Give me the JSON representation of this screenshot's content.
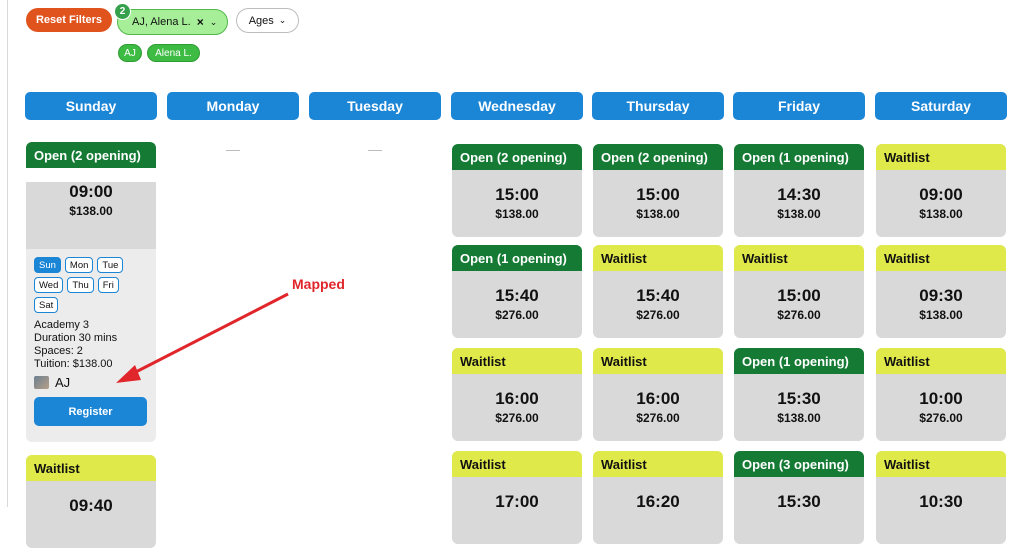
{
  "filters": {
    "reset_label": "Reset Filters",
    "selected_count": "2",
    "coach_filter_label": "AJ, Alena L.",
    "clear_symbol": "×",
    "ages_label": "Ages",
    "tags": [
      "AJ",
      "Alena L."
    ]
  },
  "days": [
    "Sunday",
    "Monday",
    "Tuesday",
    "Wednesday",
    "Thursday",
    "Friday",
    "Saturday"
  ],
  "empty_marker": "—",
  "expanded": {
    "status": "Open (2 opening)",
    "time": "09:00",
    "price": "$138.00",
    "day_pills": [
      "Sun",
      "Mon",
      "Tue",
      "Wed",
      "Thu",
      "Fri",
      "Sat"
    ],
    "selected_day": "Sun",
    "program": "Academy 3",
    "duration": "Duration 30 mins",
    "spaces": "Spaces: 2",
    "tuition": "Tuition: $138.00",
    "coach": "AJ",
    "register_label": "Register"
  },
  "annotation": {
    "label": "Mapped",
    "color": "#e0262a"
  },
  "columns": {
    "sunday": [
      {
        "status": "Waitlist",
        "type": "wait",
        "time": "09:40",
        "price": ""
      }
    ],
    "wednesday": [
      {
        "status": "Open (2 opening)",
        "type": "open",
        "time": "15:00",
        "price": "$138.00"
      },
      {
        "status": "Open (1 opening)",
        "type": "open",
        "time": "15:40",
        "price": "$276.00"
      },
      {
        "status": "Waitlist",
        "type": "wait",
        "time": "16:00",
        "price": "$276.00"
      },
      {
        "status": "Waitlist",
        "type": "wait",
        "time": "17:00",
        "price": ""
      }
    ],
    "thursday": [
      {
        "status": "Open (2 opening)",
        "type": "open",
        "time": "15:00",
        "price": "$138.00"
      },
      {
        "status": "Waitlist",
        "type": "wait",
        "time": "15:40",
        "price": "$276.00"
      },
      {
        "status": "Waitlist",
        "type": "wait",
        "time": "16:00",
        "price": "$276.00"
      },
      {
        "status": "Waitlist",
        "type": "wait",
        "time": "16:20",
        "price": ""
      }
    ],
    "friday": [
      {
        "status": "Open (1 opening)",
        "type": "open",
        "time": "14:30",
        "price": "$138.00"
      },
      {
        "status": "Waitlist",
        "type": "wait",
        "time": "15:00",
        "price": "$276.00"
      },
      {
        "status": "Open (1 opening)",
        "type": "open",
        "time": "15:30",
        "price": "$138.00"
      },
      {
        "status": "Open (3 opening)",
        "type": "open",
        "time": "15:30",
        "price": ""
      }
    ],
    "saturday": [
      {
        "status": "Waitlist",
        "type": "wait",
        "time": "09:00",
        "price": "$138.00"
      },
      {
        "status": "Waitlist",
        "type": "wait",
        "time": "09:30",
        "price": "$138.00"
      },
      {
        "status": "Waitlist",
        "type": "wait",
        "time": "10:00",
        "price": "$276.00"
      },
      {
        "status": "Waitlist",
        "type": "wait",
        "time": "10:30",
        "price": ""
      }
    ]
  },
  "colors": {
    "primary": "#1b85d6",
    "open": "#157a34",
    "waitlist": "#dfe949",
    "reset": "#e0531d",
    "chip": "#a6ef98"
  }
}
